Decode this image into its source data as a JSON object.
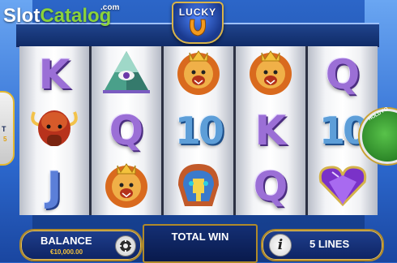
{
  "brand": {
    "part1": "Slot",
    "part2": "Catalog",
    "suffix": ".com"
  },
  "game": {
    "logo_text": "LUCKY"
  },
  "reels": [
    [
      "K",
      "bison",
      "J"
    ],
    [
      "pyramid",
      "Q",
      "lion"
    ],
    [
      "lion",
      "10",
      "mask"
    ],
    [
      "lion",
      "K",
      "Q"
    ],
    [
      "Q",
      "10",
      "gem"
    ]
  ],
  "symbols": {
    "K": {
      "type": "letter",
      "text": "K"
    },
    "Q": {
      "type": "letter",
      "text": "Q"
    },
    "J": {
      "type": "letter",
      "text": "J"
    },
    "10": {
      "type": "ten",
      "text": "10"
    },
    "bison": {
      "type": "icon",
      "icon": "bison-icon"
    },
    "lion": {
      "type": "icon",
      "icon": "lion-icon"
    },
    "pyramid": {
      "type": "icon",
      "icon": "pyramid-icon"
    },
    "mask": {
      "type": "icon",
      "icon": "mask-icon"
    },
    "gem": {
      "type": "icon",
      "icon": "heart-gem-icon"
    }
  },
  "side": {
    "left_letter": "T",
    "left_value": "5",
    "hold_label": "HOLD FO"
  },
  "footer": {
    "balance_label": "BALANCE",
    "balance_value": "€10,000.00",
    "total_win_label": "TOTAL WIN",
    "info_glyph": "i",
    "lines_label": "5 LINES"
  },
  "colors": {
    "letter_purple": "#9b6fd6",
    "ten_blue": "#5d9ed8",
    "panel_gold": "#b08a2a",
    "brand_green": "#8bd33b"
  }
}
